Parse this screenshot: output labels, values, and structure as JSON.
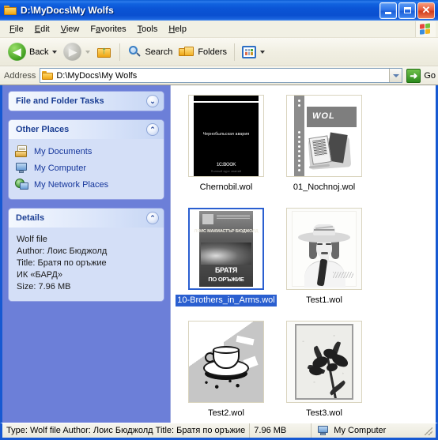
{
  "window": {
    "title": "D:\\MyDocs\\My Wolfs",
    "icon": "folder-icon",
    "buttons": {
      "minimize": "_",
      "maximize": "□",
      "close": "✕"
    }
  },
  "menu": {
    "items": [
      {
        "label": "File",
        "accel": "F"
      },
      {
        "label": "Edit",
        "accel": "E"
      },
      {
        "label": "View",
        "accel": "V"
      },
      {
        "label": "Favorites",
        "accel": "a"
      },
      {
        "label": "Tools",
        "accel": "T"
      },
      {
        "label": "Help",
        "accel": "H"
      }
    ],
    "logo": "windows-flag-icon"
  },
  "toolbar": {
    "back_label": "Back",
    "forward_label": "",
    "up_label": "",
    "search_label": "Search",
    "folders_label": "Folders",
    "views_label": ""
  },
  "address": {
    "label": "Address",
    "value": "D:\\MyDocs\\My Wolfs",
    "placeholder": "D:\\MyDocs\\My Wolfs",
    "go_label": "Go"
  },
  "sidebar": {
    "panels": [
      {
        "title": "File and Folder Tasks",
        "state": "collapsed",
        "chevron": "chevron-down",
        "items": []
      },
      {
        "title": "Other Places",
        "state": "expanded",
        "chevron": "chevron-up",
        "items": [
          {
            "label": "My Documents",
            "icon": "my-documents-icon"
          },
          {
            "label": "My Computer",
            "icon": "my-computer-icon"
          },
          {
            "label": "My Network Places",
            "icon": "my-network-places-icon"
          }
        ]
      },
      {
        "title": "Details",
        "state": "expanded",
        "chevron": "chevron-up",
        "lines": [
          "Wolf file",
          "Author: Лоис Бюджолд",
          "Title: Братя по оръжие",
          "ИК «БАРД»",
          "Size: 7.96 MB"
        ]
      }
    ]
  },
  "files": [
    {
      "name": "Chernobil.wol",
      "selected": false,
      "thumb": "chernobil-cover",
      "thumb_text": {
        "title": "Чернобыльская авария",
        "logo": "1C:BOOK",
        "sub": "Полный курс знаний"
      }
    },
    {
      "name": "01_Nochnoj.wol",
      "selected": false,
      "thumb": "wol-promo",
      "thumb_text": {
        "brand": "WOL"
      }
    },
    {
      "name": "10-Brothers_in_Arms.wol",
      "selected": true,
      "thumb": "brothers-in-arms-cover",
      "thumb_text": {
        "author": "ЛОИС МАКМАСТЪР БЮДЖОЛД",
        "title1": "БРАТЯ",
        "title2": "ПО ОРЪЖИЕ"
      }
    },
    {
      "name": "Test1.wol",
      "selected": false,
      "thumb": "lady-with-hat",
      "thumb_text": {}
    },
    {
      "name": "Test2.wol",
      "selected": false,
      "thumb": "coffee-cup",
      "thumb_text": {}
    },
    {
      "name": "Test3.wol",
      "selected": false,
      "thumb": "flower-sketch",
      "thumb_text": {}
    }
  ],
  "statusbar": {
    "info": "Type: Wolf file Author: Лоис Бюджолд Title: Братя по оръжие",
    "size": "7.96 MB",
    "location": "My Computer",
    "location_icon": "my-computer-icon"
  },
  "colors": {
    "titlebar_blue": "#0B55D6",
    "sidebar_blue": "#6C7FD8",
    "selection_blue": "#2A5FD0",
    "panel_header": "#DCE6FA",
    "panel_body": "#D4DFF7",
    "link_blue": "#15369B",
    "toolbar_bg": "#F1EFE2"
  }
}
